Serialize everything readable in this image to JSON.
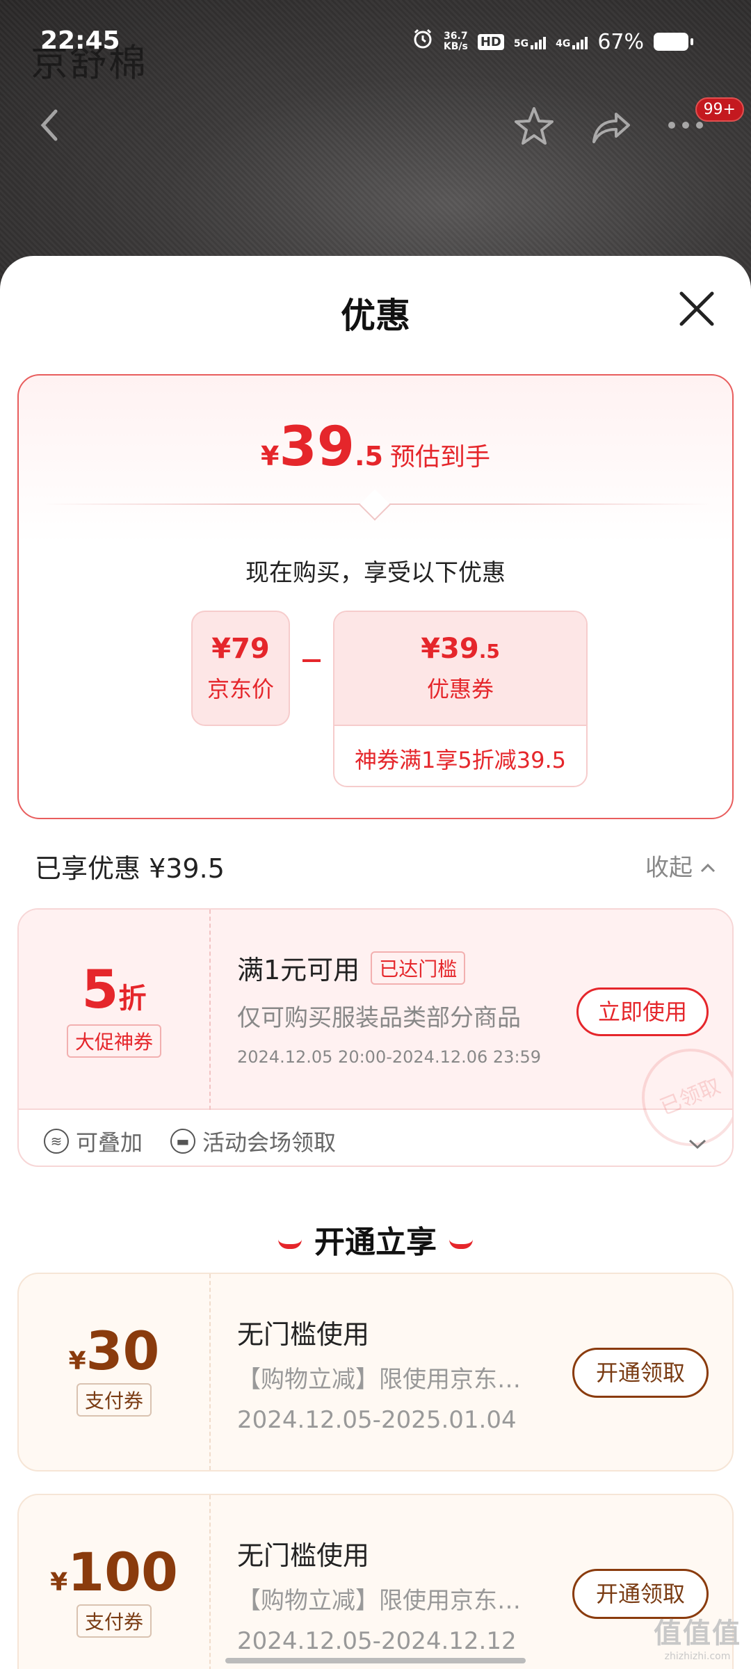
{
  "status_bar": {
    "time": "22:45",
    "net_speed_top": "36.7",
    "net_speed_bottom": "KB/s",
    "hd_label": "HD",
    "sim1": "5G",
    "sim2": "4G",
    "battery": "67%"
  },
  "header": {
    "brand_logo_text": "京舒棉",
    "badge": "99+"
  },
  "sheet": {
    "title": "优惠"
  },
  "summary": {
    "currency": "¥",
    "price_int": "39",
    "price_dec": ".5",
    "price_label": "预估到手",
    "subhead": "现在购买，享受以下优惠",
    "jd_price_value": "¥79",
    "jd_price_label": "京东价",
    "coupon_value_int": "¥39",
    "coupon_value_dec": ".5",
    "coupon_label": "优惠券",
    "coupon_detail": "神券满1享5折减39.5"
  },
  "enjoyed": {
    "label": "已享优惠 ¥39.5",
    "collapse_label": "收起"
  },
  "coupon_red": {
    "discount_num": "5",
    "discount_unit": "折",
    "type_tag": "大促神券",
    "title": "满1元可用",
    "threshold_tag": "已达门槛",
    "desc": "仅可购买服装品类部分商品",
    "date": "2024.12.05 20:00-2024.12.06 23:59",
    "button": "立即使用",
    "stamp": "已领取",
    "footer_stack": "可叠加",
    "footer_source": "活动会场领取"
  },
  "section": {
    "title": "开通立享"
  },
  "gold_coupons": [
    {
      "currency": "¥",
      "amount": "30",
      "type_tag": "支付券",
      "title": "无门槛使用",
      "desc": "【购物立减】限使用京东…",
      "date": "2024.12.05-2025.01.04",
      "button": "开通领取"
    },
    {
      "currency": "¥",
      "amount": "100",
      "type_tag": "支付券",
      "title": "无门槛使用",
      "desc": "【购物立减】限使用京东…",
      "date": "2024.12.05-2024.12.12",
      "button": "开通领取"
    }
  ],
  "watermark": {
    "top": "值值值",
    "bottom": "zhizhizhi.com"
  },
  "colors": {
    "accent_red": "#e5262b",
    "gold_brown": "#8a3b0d"
  }
}
